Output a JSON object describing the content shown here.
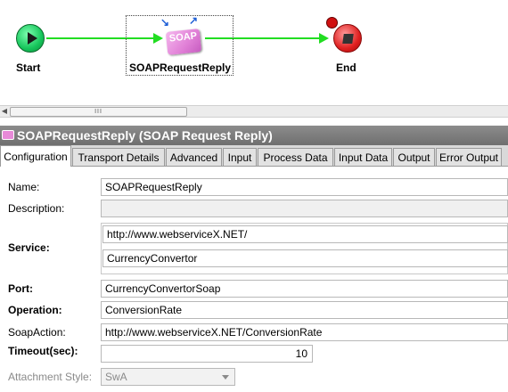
{
  "canvas": {
    "start_label": "Start",
    "activity_label": "SOAPRequestReply",
    "activity_icon_text": "SOAP",
    "end_label": "End",
    "connector_color": "#22dd22"
  },
  "panel": {
    "title": "SOAPRequestReply (SOAP Request Reply)",
    "title_icon": "soap-activity-icon",
    "tabs": [
      {
        "label": "Configuration",
        "active": true
      },
      {
        "label": "Transport Details",
        "active": false
      },
      {
        "label": "Advanced",
        "active": false
      },
      {
        "label": "Input",
        "active": false
      },
      {
        "label": "Process Data",
        "active": false
      },
      {
        "label": "Input Data",
        "active": false
      },
      {
        "label": "Output",
        "active": false
      },
      {
        "label": "Error Output",
        "active": false
      }
    ]
  },
  "form": {
    "name_label": "Name:",
    "name_value": "SOAPRequestReply",
    "description_label": "Description:",
    "description_value": "",
    "service_label": "Service:",
    "service_url": "http://www.webserviceX.NET/",
    "service_name": "CurrencyConvertor",
    "port_label": "Port:",
    "port_value": "CurrencyConvertorSoap",
    "operation_label": "Operation:",
    "operation_value": "ConversionRate",
    "soapaction_label": "SoapAction:",
    "soapaction_value": "http://www.webserviceX.NET/ConversionRate",
    "timeout_label": "Timeout(sec):",
    "timeout_value": "10",
    "attachment_label": "Attachment Style:",
    "attachment_value": "SwA"
  },
  "scrollbar": {
    "thumb_grip": "III"
  }
}
